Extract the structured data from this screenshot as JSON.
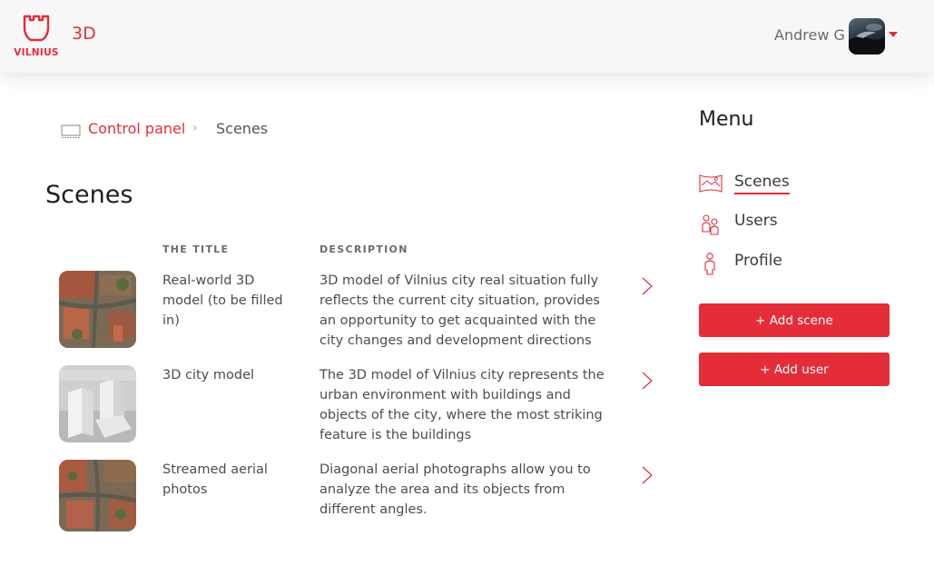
{
  "header": {
    "logo_text": "VILNIUS",
    "app_title": "3D",
    "user_name": "Andrew G"
  },
  "breadcrumb": {
    "parent_label": "Control panel",
    "separator": "›",
    "current_label": "Scenes"
  },
  "main": {
    "title": "Scenes",
    "columns": [
      "THE TITLE",
      "DESCRIPTION"
    ],
    "rows": [
      {
        "title": "Real-world 3D model (to be filled in)",
        "description": "3D model of Vilnius city real situation fully reflects the current city situation, provides an opportunity to get acquainted with the city changes and development directions",
        "thumbnail": "aerial-photo-thumbnail"
      },
      {
        "title": "3D city model",
        "description": "The 3D model of Vilnius city represents the urban environment with buildings and objects of the city, where the most striking feature is the buildings",
        "thumbnail": "3d-buildings-thumbnail"
      },
      {
        "title": "Streamed aerial photos",
        "description": "Diagonal aerial photographs allow you to analyze the area and its objects from different angles.",
        "thumbnail": "aerial-photo-thumbnail"
      }
    ]
  },
  "menu": {
    "title": "Menu",
    "items": [
      {
        "label": "Scenes",
        "icon": "panorama-icon",
        "active": true
      },
      {
        "label": "Users",
        "icon": "users-icon",
        "active": false
      },
      {
        "label": "Profile",
        "icon": "profile-icon",
        "active": false
      }
    ],
    "add_scene_label": "+ Add scene",
    "add_user_label": "+ Add user"
  },
  "colors": {
    "accent": "#e52d3a",
    "header_bg": "#f7f7f7",
    "text": "#4a4a4a"
  }
}
